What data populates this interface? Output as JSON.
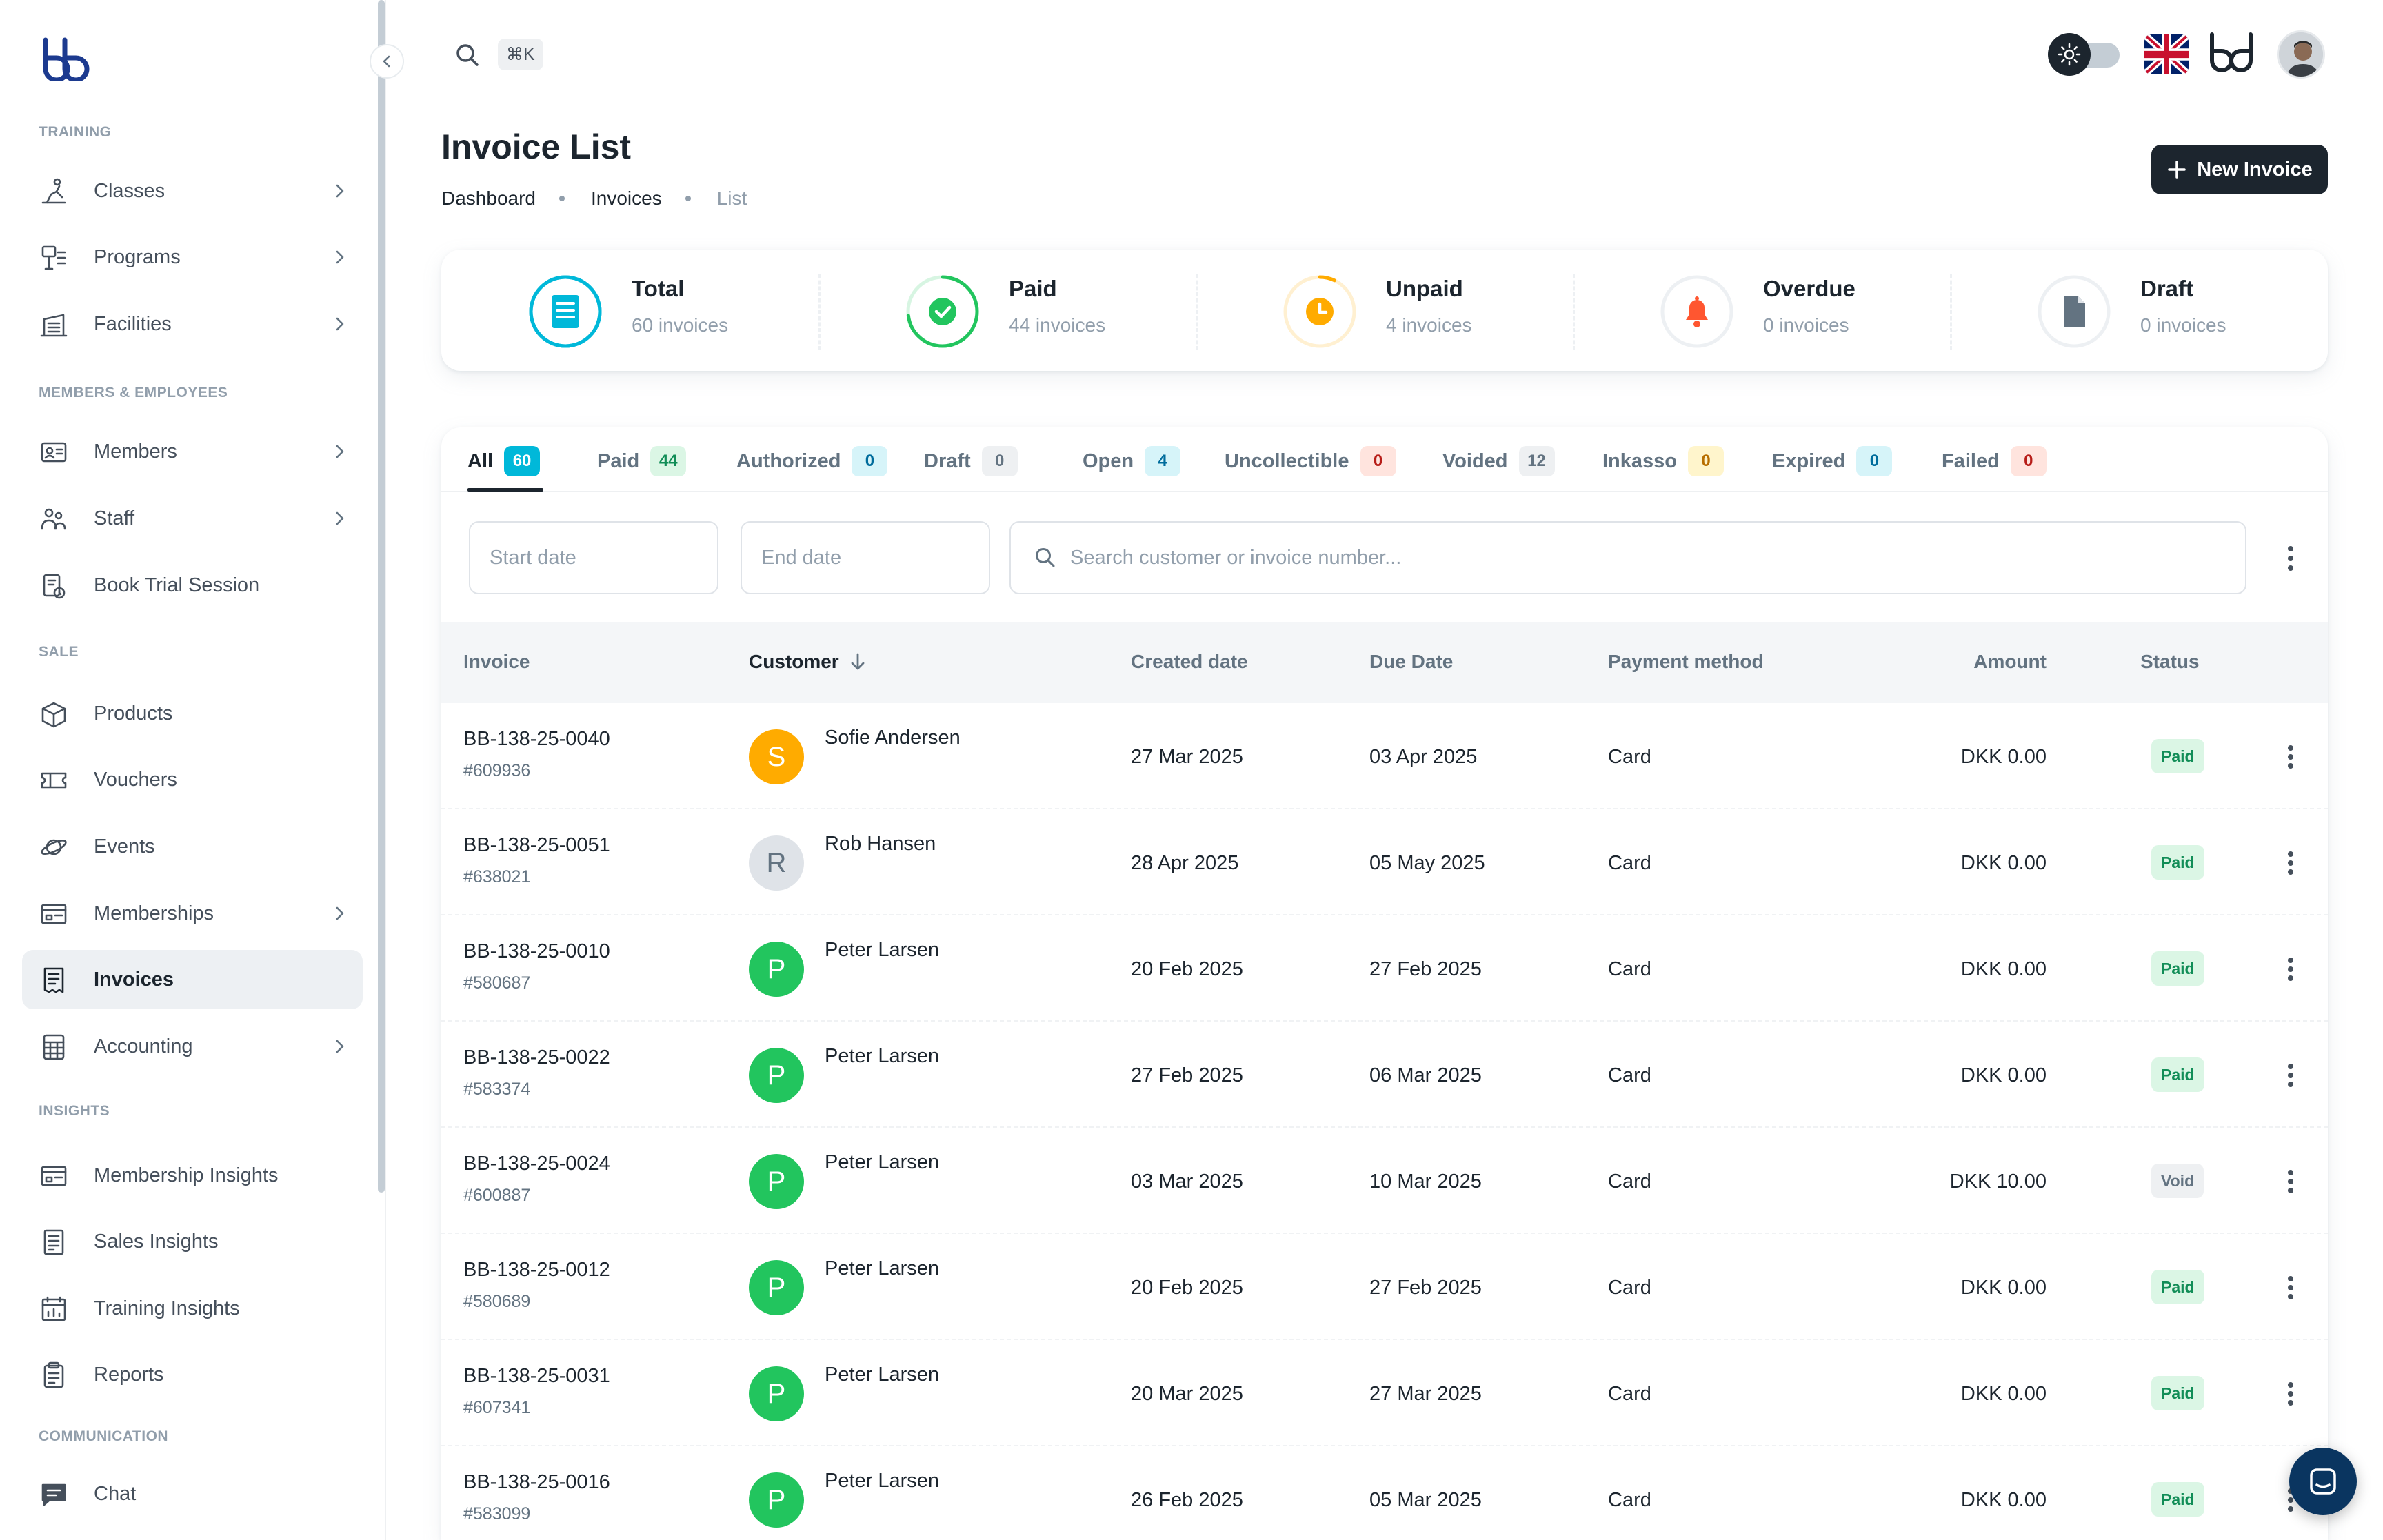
{
  "header": {
    "search_shortcut": "⌘K"
  },
  "sidebar": {
    "sections": [
      {
        "title": "TRAINING"
      },
      {
        "title": "MEMBERS & EMPLOYEES"
      },
      {
        "title": "SALE"
      },
      {
        "title": "INSIGHTS"
      },
      {
        "title": "COMMUNICATION"
      }
    ],
    "items": [
      {
        "label": "Classes",
        "icon": "stretching-person-icon",
        "chevron": true
      },
      {
        "label": "Programs",
        "icon": "program-board-icon",
        "chevron": true
      },
      {
        "label": "Facilities",
        "icon": "gym-building-icon",
        "chevron": true
      },
      {
        "label": "Members",
        "icon": "id-card-icon",
        "chevron": true
      },
      {
        "label": "Staff",
        "icon": "staff-people-icon",
        "chevron": true
      },
      {
        "label": "Book Trial Session",
        "icon": "clipboard-clock-icon",
        "chevron": false
      },
      {
        "label": "Products",
        "icon": "package-box-icon",
        "chevron": false
      },
      {
        "label": "Vouchers",
        "icon": "ticket-icon",
        "chevron": false
      },
      {
        "label": "Events",
        "icon": "planet-icon",
        "chevron": false
      },
      {
        "label": "Memberships",
        "icon": "membership-card-icon",
        "chevron": true
      },
      {
        "label": "Invoices",
        "icon": "invoice-doc-icon",
        "chevron": false,
        "active": true
      },
      {
        "label": "Accounting",
        "icon": "calculator-icon",
        "chevron": true
      },
      {
        "label": "Membership Insights",
        "icon": "membership-card-icon",
        "chevron": false
      },
      {
        "label": "Sales Insights",
        "icon": "receipt-icon",
        "chevron": false
      },
      {
        "label": "Training Insights",
        "icon": "calendar-chart-icon",
        "chevron": false
      },
      {
        "label": "Reports",
        "icon": "clipboard-icon",
        "chevron": false
      },
      {
        "label": "Chat",
        "icon": "chat-bubble-icon",
        "chevron": false
      }
    ]
  },
  "page": {
    "title": "Invoice List",
    "breadcrumb": [
      "Dashboard",
      "Invoices",
      "List"
    ],
    "new_button": "New Invoice"
  },
  "stats": [
    {
      "title": "Total",
      "sub": "60 invoices",
      "color": "#00b8d9",
      "progress": 1.0
    },
    {
      "title": "Paid",
      "sub": "44 invoices",
      "color": "#22c55e",
      "progress": 0.73
    },
    {
      "title": "Unpaid",
      "sub": "4 invoices",
      "color": "#ffab00",
      "progress": 0.07
    },
    {
      "title": "Overdue",
      "sub": "0 invoices",
      "color": "#ff5630",
      "progress": 0
    },
    {
      "title": "Draft",
      "sub": "0 invoices",
      "color": "#637381",
      "progress": 0
    }
  ],
  "tabs": [
    {
      "label": "All",
      "count": "60",
      "bg": "#00b8d9",
      "fg": "#ffffff",
      "active": true
    },
    {
      "label": "Paid",
      "count": "44",
      "bg": "#dbf6e5",
      "fg": "#118d57"
    },
    {
      "label": "Authorized",
      "count": "0",
      "bg": "#d6f4f9",
      "fg": "#006c9c"
    },
    {
      "label": "Draft",
      "count": "0",
      "bg": "#eef0f2",
      "fg": "#637381"
    },
    {
      "label": "Open",
      "count": "4",
      "bg": "#d6f4f9",
      "fg": "#006c9c"
    },
    {
      "label": "Uncollectible",
      "count": "0",
      "bg": "#ffe4de",
      "fg": "#b71d18"
    },
    {
      "label": "Voided",
      "count": "12",
      "bg": "#eef0f2",
      "fg": "#637381"
    },
    {
      "label": "Inkasso",
      "count": "0",
      "bg": "#fff5cc",
      "fg": "#b76e00"
    },
    {
      "label": "Expired",
      "count": "0",
      "bg": "#d6f4f9",
      "fg": "#006c9c"
    },
    {
      "label": "Failed",
      "count": "0",
      "bg": "#ffe4de",
      "fg": "#b71d18"
    }
  ],
  "filters": {
    "start_date": "Start date",
    "end_date": "End date",
    "search": "Search customer or invoice number..."
  },
  "columns": [
    "Invoice",
    "Customer",
    "Created date",
    "Due Date",
    "Payment method",
    "Amount",
    "Status"
  ],
  "rows": [
    {
      "invoice": "BB-138-25-0040",
      "id": "#609936",
      "initial": "S",
      "avatar_color": "#ffab00",
      "customer": "Sofie Andersen",
      "created": "27 Mar 2025",
      "due": "03 Apr 2025",
      "method": "Card",
      "amount": "DKK 0.00",
      "status": "Paid"
    },
    {
      "invoice": "BB-138-25-0051",
      "id": "#638021",
      "initial": "R",
      "avatar_color": "#dfe3e8",
      "customer": "Rob Hansen",
      "created": "28 Apr 2025",
      "due": "05 May 2025",
      "method": "Card",
      "amount": "DKK 0.00",
      "status": "Paid"
    },
    {
      "invoice": "BB-138-25-0010",
      "id": "#580687",
      "initial": "P",
      "avatar_color": "#22c55e",
      "customer": "Peter Larsen",
      "created": "20 Feb 2025",
      "due": "27 Feb 2025",
      "method": "Card",
      "amount": "DKK 0.00",
      "status": "Paid"
    },
    {
      "invoice": "BB-138-25-0022",
      "id": "#583374",
      "initial": "P",
      "avatar_color": "#22c55e",
      "customer": "Peter Larsen",
      "created": "27 Feb 2025",
      "due": "06 Mar 2025",
      "method": "Card",
      "amount": "DKK 0.00",
      "status": "Paid"
    },
    {
      "invoice": "BB-138-25-0024",
      "id": "#600887",
      "initial": "P",
      "avatar_color": "#22c55e",
      "customer": "Peter Larsen",
      "created": "03 Mar 2025",
      "due": "10 Mar 2025",
      "method": "Card",
      "amount": "DKK 10.00",
      "status": "Void"
    },
    {
      "invoice": "BB-138-25-0012",
      "id": "#580689",
      "initial": "P",
      "avatar_color": "#22c55e",
      "customer": "Peter Larsen",
      "created": "20 Feb 2025",
      "due": "27 Feb 2025",
      "method": "Card",
      "amount": "DKK 0.00",
      "status": "Paid"
    },
    {
      "invoice": "BB-138-25-0031",
      "id": "#607341",
      "initial": "P",
      "avatar_color": "#22c55e",
      "customer": "Peter Larsen",
      "created": "20 Mar 2025",
      "due": "27 Mar 2025",
      "method": "Card",
      "amount": "DKK 0.00",
      "status": "Paid"
    },
    {
      "invoice": "BB-138-25-0016",
      "id": "#583099",
      "initial": "P",
      "avatar_color": "#22c55e",
      "customer": "Peter Larsen",
      "created": "26 Feb 2025",
      "due": "05 Mar 2025",
      "method": "Card",
      "amount": "DKK 0.00",
      "status": "Paid"
    }
  ]
}
